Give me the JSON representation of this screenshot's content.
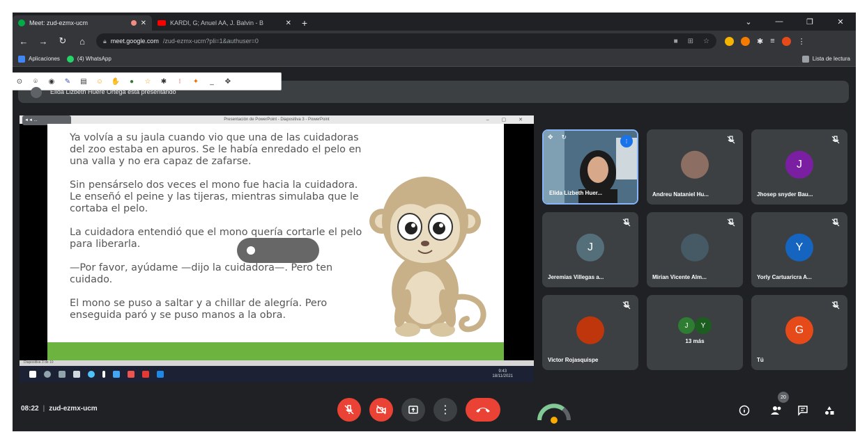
{
  "browser": {
    "tabs": [
      {
        "title": "Meet: zud-ezmx-ucm",
        "active": true
      },
      {
        "title": "KARDI, G; Anuel AA, J. Balvin - B",
        "active": false
      }
    ],
    "new_tab": "+",
    "window_controls": {
      "minimize": "—",
      "restore": "❐",
      "close": "✕",
      "menu": "⌄"
    },
    "url_host": "meet.google.com",
    "url_path": "/zud-ezmx-ucm?pli=1&authuser=0",
    "bookmarks": [
      {
        "label": "Aplicaciones",
        "icon": "apps-grid-icon"
      },
      {
        "label": "(4) WhatsApp",
        "icon": "whatsapp-icon"
      }
    ],
    "reading_list": "Lista de lectura"
  },
  "annotation_toolbar": {
    "tools": [
      "⊙",
      "⌾",
      "◉",
      "✎",
      "▤",
      "☺",
      "✋",
      "●",
      "☆",
      "✱",
      "⁝",
      "✦",
      "_",
      "✥"
    ]
  },
  "presenting": {
    "banner": "Elida Lizbeth Huere Ortega está presentando"
  },
  "shared_screen": {
    "window_title": "Presentación de PowerPoint - Diapositiva 3 - PowerPoint",
    "chip": "◄◄ ...",
    "status_text": "Diapositiva 3 de 10",
    "clock_time": "9:43",
    "clock_date": "18/11/2021",
    "paragraphs": [
      "Ya volvía a su jaula cuando vio que una de las cuidadoras del zoo estaba en apuros. Se le había enredado el pelo en una valla y no era capaz de zafarse.",
      "Sin pensárselo dos veces el mono fue hacia la cuidadora. Le enseñó el peine y las tijeras, mientras simulaba que le cortaba el pelo.",
      "La cuidadora entendió que el mono quería cortarle el pelo para liberarla.",
      "—Por favor, ayúdame —dijo la cuidadora—. Pero ten cuidado.",
      "El mono se puso a saltar y a chillar de alegría. Pero enseguida paró y se puso manos a la obra."
    ]
  },
  "participants": [
    {
      "name": "Elida Lizbeth Huer...",
      "type": "video"
    },
    {
      "name": "Andreu Nataniel Hu...",
      "initial": "",
      "color": "#8d6e63",
      "type": "photo"
    },
    {
      "name": "Jhosep snyder Bau...",
      "initial": "J",
      "color": "#7b1fa2",
      "type": "letter"
    },
    {
      "name": "Jeremias Villegas a...",
      "initial": "J",
      "color": "#546e7a",
      "type": "letter"
    },
    {
      "name": "Mirian Vicente Alm...",
      "initial": "",
      "color": "#455a64",
      "type": "photo"
    },
    {
      "name": "Yorly Cartuaricra A...",
      "initial": "Y",
      "color": "#1565c0",
      "type": "letter"
    },
    {
      "name": "Victor Rojasquispe",
      "initial": "",
      "color": "#bf360c",
      "type": "photo"
    },
    {
      "name": "13 más",
      "initials": [
        "J",
        "Y"
      ],
      "colors": [
        "#2e7d32",
        "#1b5e20"
      ],
      "type": "more"
    },
    {
      "name": "Tú",
      "initial": "G",
      "color": "#e64a19",
      "type": "letter"
    }
  ],
  "controls": {
    "time": "08:22",
    "separator": "|",
    "meeting_code": "zud-ezmx-ucm",
    "participant_count": "20"
  },
  "colors": {
    "meet_bg": "#202124",
    "tile_bg": "#3c4043",
    "end_call": "#ea4335",
    "speaking_blue": "#1a73e8",
    "grass": "#6cb33f"
  }
}
